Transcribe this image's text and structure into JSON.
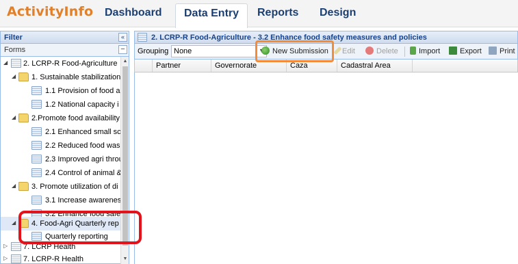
{
  "app": {
    "brand": "ActivityInfo",
    "tabs": [
      "Dashboard",
      "Data Entry",
      "Reports",
      "Design"
    ],
    "active_tab": "Data Entry"
  },
  "filter_panel": {
    "title": "Filter",
    "collapse_glyph": "«",
    "forms_label": "Forms",
    "forms_collapse_glyph": "−"
  },
  "tree": [
    {
      "label": "2. LCRP-R Food-Agriculture",
      "icon": "database-icon",
      "arrow": "◢"
    },
    {
      "label": "1. Sustainable stabilization",
      "icon": "folder-icon",
      "arrow": "◢"
    },
    {
      "label": "1.1 Provision of food a",
      "icon": "form-icon",
      "arrow": ""
    },
    {
      "label": "1.2 National capacity i",
      "icon": "form-icon",
      "arrow": ""
    },
    {
      "label": "2.Promote food availability",
      "icon": "folder-icon",
      "arrow": "◢"
    },
    {
      "label": "2.1 Enhanced small sc",
      "icon": "form-icon",
      "arrow": ""
    },
    {
      "label": "2.2 Reduced food was",
      "icon": "form-icon",
      "arrow": ""
    },
    {
      "label": "2.3 Improved agri throu",
      "icon": "form-icon",
      "arrow": ""
    },
    {
      "label": "2.4 Control of animal &",
      "icon": "form-icon",
      "arrow": ""
    },
    {
      "label": "3. Promote utilization of di",
      "icon": "folder-icon",
      "arrow": "◢"
    },
    {
      "label": "3.1 Increase awarenes",
      "icon": "form-icon",
      "arrow": ""
    },
    {
      "label": "3.2 Enhance food safe",
      "icon": "form-icon",
      "arrow": ""
    },
    {
      "label": "4. Food-Agri Quarterly rep",
      "icon": "folder-icon",
      "arrow": "◢"
    },
    {
      "label": "Quarterly reporting",
      "icon": "form-icon",
      "arrow": ""
    },
    {
      "label": "7. LCRP Health",
      "icon": "database-icon",
      "arrow": "▷"
    },
    {
      "label": "7. LCRP-R Health",
      "icon": "database-icon",
      "arrow": "▷"
    }
  ],
  "main": {
    "title": "2. LCRP-R Food-Agriculture - 3.2 Enhance food safety measures and policies",
    "toolbar": {
      "grouping_label": "Grouping",
      "grouping_value": "None",
      "new_submission": "New Submission",
      "edit": "Edit",
      "delete": "Delete",
      "import": "Import",
      "export": "Export",
      "print": "Print"
    },
    "columns": [
      "Partner",
      "Governorate",
      "Caza",
      "Cadastral Area"
    ]
  },
  "colors": {
    "brand": "#e2802a",
    "nav_text": "#1b3f73",
    "highlight_orange": "#f28c38",
    "highlight_red": "#e3131b"
  }
}
